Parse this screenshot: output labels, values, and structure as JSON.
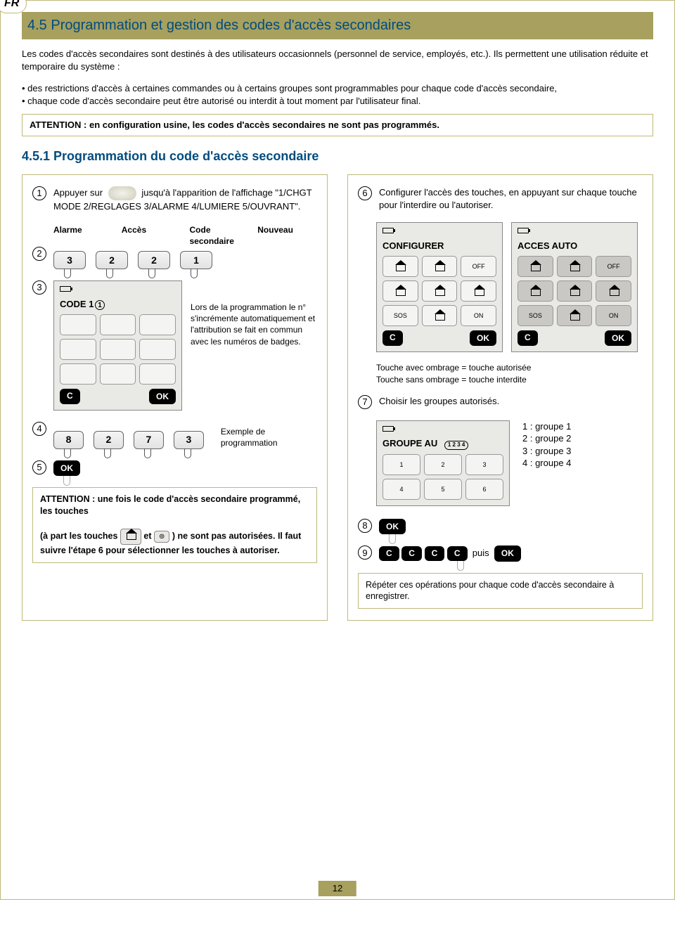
{
  "lang_badge": "FR",
  "title": "4.5 Programmation et gestion des codes d'accès secondaires",
  "intro": "Les codes d'accès secondaires sont destinés à des utilisateurs occasionnels (personnel de service, employés, etc.). Ils permettent une utilisation réduite et temporaire du système :",
  "bullets": [
    "des restrictions d'accès à certaines commandes ou à certains groupes sont programmables pour chaque code d'accès secondaire,",
    "chaque code d'accès secondaire peut être autorisé ou interdit à tout moment par l'utilisateur final."
  ],
  "notice": "ATTENTION : en configuration usine, les codes d'accès secondaires ne sont pas programmés.",
  "subhead": "4.5.1 Programmation du code d'accès secondaire",
  "left": {
    "step1_a": "Appuyer sur",
    "step1_b": "jusqu'à l'apparition de l'affichage \"1/CHGT MODE  2/REGLAGES 3/ALARME  4/LUMIERE  5/OUVRANT\".",
    "labels": [
      "Alarme",
      "Accès",
      "Code secondaire",
      "Nouveau"
    ],
    "step2_keys": [
      "3",
      "2",
      "2",
      "1"
    ],
    "step3_title": "CODE 1",
    "step3_note": "Lors de la programmation le n° s'incrémente automatiquement et l'attribution se fait en commun avec les numéros de badges.",
    "step4_keys": [
      "8",
      "2",
      "7",
      "3"
    ],
    "step4_note": "Exemple de programmation",
    "step5_btn": "OK",
    "attn_a": "ATTENTION : une fois le code d'accès secondaire programmé, les touches",
    "attn_b": "(à part les touches",
    "attn_c": "et",
    "attn_d": ") ne sont pas autorisées. Il faut suivre l'étape 6 pour sélectionner les touches à autoriser."
  },
  "right": {
    "step6": "Configurer l'accès des touches, en appuyant sur chaque touche pour l'interdire ou l'autoriser.",
    "lcd1_title": "CONFIGURER",
    "lcd2_title": "ACCES AUTO",
    "cell_labels": [
      "?",
      "OFF",
      "",
      "",
      "",
      "",
      "SOS",
      "",
      "ON"
    ],
    "c_label": "C",
    "ok_label": "OK",
    "shade_note1": "Touche avec ombrage = touche autorisée",
    "shade_note2": "Touche sans ombrage = touche interdite",
    "step7": "Choisir les groupes autorisés.",
    "group_title": "GROUPE  AU",
    "group_badge": "1 2 3 4",
    "group_keys": [
      "1",
      "2",
      "3",
      "4",
      "5",
      "6"
    ],
    "legend": [
      "1 : groupe 1",
      "2 : groupe 2",
      "3 : groupe 3",
      "4 : groupe 4"
    ],
    "step8_btn": "OK",
    "step9_puisk": "puis",
    "step9_ok": "OK",
    "step9_c": "C",
    "repeat_note": "Répéter ces opérations pour chaque code d'accès secondaire à enregistrer."
  },
  "page_number": "12"
}
